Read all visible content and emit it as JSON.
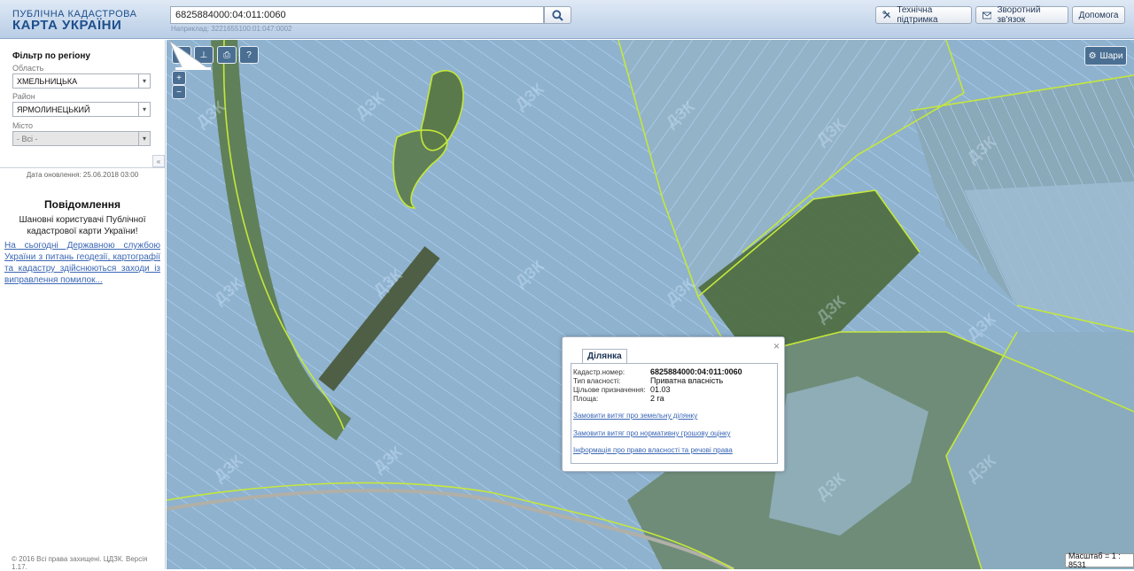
{
  "header": {
    "logo_line1": "ПУБЛІЧНА КАДАСТРОВА",
    "logo_line2": "КАРТА УКРАЇНИ",
    "search_value": "6825884000:04:011:0060",
    "search_hint": "Наприклад: 3221655100:01:047:0002",
    "buttons": [
      {
        "label": "Технічна підтримка",
        "icon": "tools-icon"
      },
      {
        "label": "Зворотний зв'язок",
        "icon": "envelope-icon"
      },
      {
        "label": "Допомога",
        "icon": ""
      }
    ]
  },
  "filter": {
    "title": "Фільтр по регіону",
    "oblast_label": "Область",
    "oblast_value": "ХМЕЛЬНИЦЬКА",
    "raion_label": "Район",
    "raion_value": "ЯРМОЛИНЕЦЬКИЙ",
    "misto_label": "Місто",
    "misto_value": "- Всі -"
  },
  "sidebar": {
    "update_date": "Дата оновлення: 25.06.2018 03:00",
    "notice_title": "Повідомлення",
    "notice_greeting": "Шановні користувачі Публічної кадастрової карти України!",
    "notice_link": "На сьогодні Державною службою України з питань геодезії, картографії та кадастру здійснюються заходи із виправлення помилок...",
    "copyright": "© 2016 Всі права захищені. ЦДЗК. Версія 1.17."
  },
  "map": {
    "layers_label": "Шари",
    "scale_label": "Масштаб = 1 : 8531",
    "zoom_in": "+",
    "zoom_out": "−",
    "watermark": "ДЗК",
    "colors": {
      "parcel_fill": "#9fc3e6",
      "parcel_stroke": "#a9d4ff",
      "boundary": "#c4e83a"
    }
  },
  "popup": {
    "tab": "Ділянка",
    "rows": [
      {
        "label": "Кадастр.номер:",
        "value": "6825884000:04:011:0060"
      },
      {
        "label": "Тип власності:",
        "value": "Приватна власність"
      },
      {
        "label": "Цільове призначення:",
        "value": "01.03"
      },
      {
        "label": "Площа:",
        "value": "2 га"
      }
    ],
    "links": [
      "Замовити витяг про земельну ділянку",
      "Замовити витяг про нормативну грошову оцінку",
      "Інформація про право власності та речові права"
    ]
  }
}
